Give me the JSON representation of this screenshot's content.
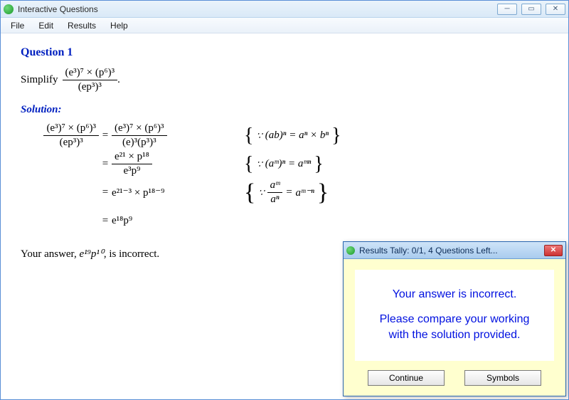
{
  "window": {
    "title": "Interactive Questions"
  },
  "menu": {
    "file": "File",
    "edit": "Edit",
    "results": "Results",
    "help": "Help"
  },
  "question": {
    "heading": "Question 1",
    "prompt_label": "Simplify",
    "expr_numer": "(e³)⁷ × (p⁶)³",
    "expr_denom": "(ep³)³",
    "period": "."
  },
  "solution": {
    "heading": "Solution:",
    "lhs_numer": "(e³)⁷ × (p⁶)³",
    "lhs_denom": "(ep³)³",
    "step1_numer": "(e³)⁷ × (p⁶)³",
    "step1_denom": "(e)³(p³)³",
    "rule1": "(ab)ⁿ = aⁿ × bⁿ",
    "step2_numer": "e²¹ × p¹⁸",
    "step2_denom": "e³p⁹",
    "rule2": "(aᵐ)ⁿ = aᵐⁿ",
    "step3": "e²¹⁻³ × p¹⁸⁻⁹",
    "rule3_numer": "aᵐ",
    "rule3_denom": "aⁿ",
    "rule3_rhs": "aᵐ⁻ⁿ",
    "step4": "e¹⁸p⁹",
    "eq": "="
  },
  "feedback": {
    "prefix": "Your answer, ",
    "user_answer": "e¹⁹p¹⁰",
    "suffix": ", is incorrect."
  },
  "dialog": {
    "title": "Results Tally:  0/1, 4 Questions Left...",
    "line1": "Your answer is incorrect.",
    "line2": "Please compare your working",
    "line3": "with the solution provided.",
    "continue": "Continue",
    "symbols": "Symbols"
  },
  "glyphs": {
    "because": "∵",
    "close_x": "✕",
    "min": "—",
    "max": "▢"
  }
}
